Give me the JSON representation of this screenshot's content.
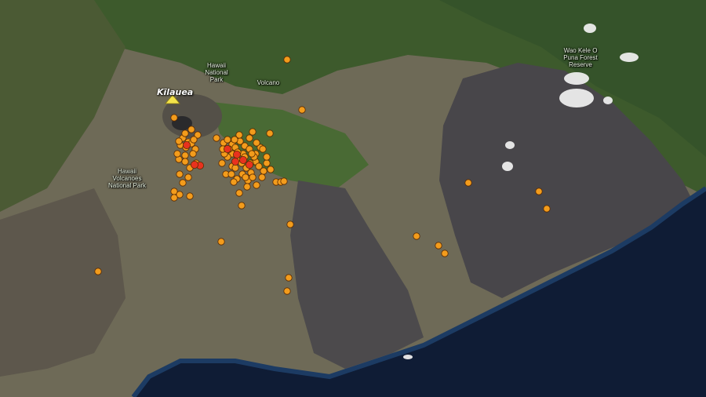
{
  "map": {
    "place_labels": [
      {
        "id": "hawaii-national-park",
        "text": "Hawaii\nNational\nPark"
      },
      {
        "id": "volcano",
        "text": "Volcano"
      },
      {
        "id": "wao-kele-o-puna",
        "text": "Wao Kele O\nPuna Forest\nReserve"
      },
      {
        "id": "hawaii-volcanoes-national-park",
        "text": "Hawaii\nVolcanoes\nNational Park"
      }
    ],
    "volcano": {
      "name": "Kīlauea",
      "marker_icon": "triangle-volcano-icon",
      "marker_color": "#f3e34a"
    },
    "earthquake_markers": {
      "colors": {
        "recent": "#e8321e",
        "older": "#f39c1c",
        "outline": "#5a2a00"
      },
      "count_recent": 8,
      "count_older": 96
    },
    "colors": {
      "ocean": "#0e1c33",
      "lava": "#4a4748",
      "vegetation": "#3f5e2e",
      "land": "#6b6352"
    }
  }
}
